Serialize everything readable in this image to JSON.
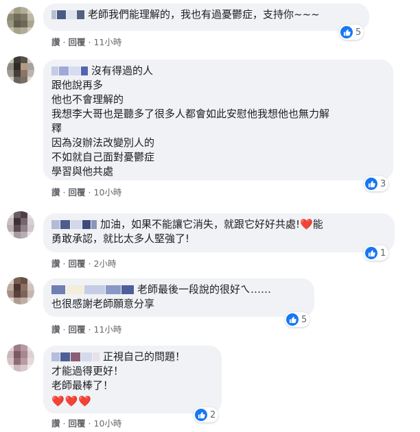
{
  "comments": [
    {
      "lines": [
        "老師我們能理解的，我也有過憂鬱症，支持你~~~"
      ],
      "actions": {
        "like": "讚",
        "reply": "回覆",
        "time": "11小時"
      },
      "reactions": "5"
    },
    {
      "lines": [
        "沒有得過的人",
        "跟他說再多",
        "他也不會理解的",
        "我想李大哥也是聽多了很多人都會如此安慰他我想他也無力解",
        "釋",
        "因為沒辦法改變別人的",
        "不如就自己面對憂鬱症",
        "學習與他共處"
      ],
      "actions": {
        "like": "讚",
        "reply": "回覆",
        "time": "10小時"
      },
      "reactions": "3"
    },
    {
      "lines": [
        "加油，如果不能讓它消失，就跟它好好共處!❤️能",
        "勇敢承認，就比太多人堅強了!"
      ],
      "actions": {
        "like": "讚",
        "reply": "回覆",
        "time": "2小時"
      },
      "reactions": "1"
    },
    {
      "lines": [
        "老師最後一段說的很好ㄟ……",
        "也很感謝老師願意分享"
      ],
      "actions": {
        "like": "讚",
        "reply": "回覆",
        "time": "11小時"
      },
      "reactions": "5"
    },
    {
      "lines": [
        "正視自己的問題！",
        "才能過得更好！",
        "老師最棒了！"
      ],
      "hearts": "❤️❤️❤️",
      "actions": {
        "like": "讚",
        "reply": "回覆",
        "time": "10小時"
      },
      "reactions": "2"
    }
  ],
  "colors": {
    "bubble": "#f0f2f5",
    "like": "#1877f2",
    "meta": "#65676b"
  }
}
